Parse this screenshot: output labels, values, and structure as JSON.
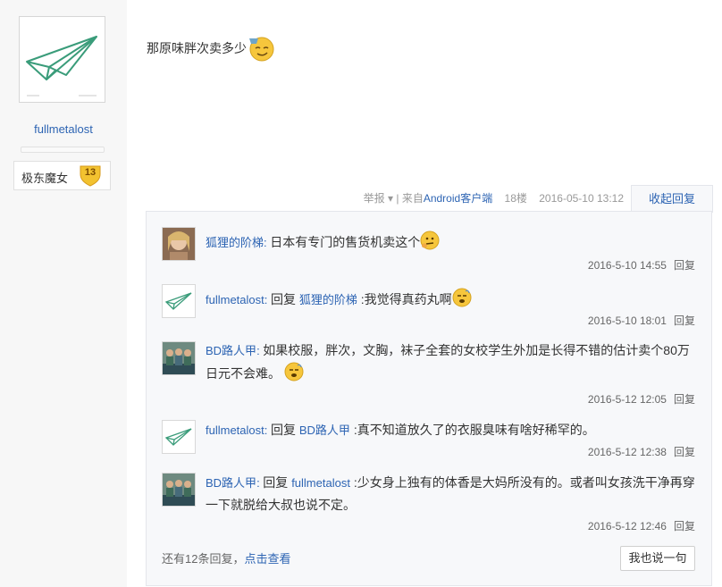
{
  "author": {
    "username": "fullmetalost",
    "badge": {
      "name": "极东魔女",
      "level": "13"
    }
  },
  "post": {
    "text": "那原味胖次卖多少",
    "meta": {
      "report": "举报",
      "source_prefix": "| 来自",
      "source": "Android客户端",
      "floor": "18楼",
      "time": "2016-05-10 13:12"
    },
    "collapse_label": "收起回复"
  },
  "replies": [
    {
      "user": "狐狸的阶梯",
      "text": "日本有专门的售货机卖这个",
      "time": "2016-5-10 14:55",
      "action": "回复"
    },
    {
      "user": "fullmetalost",
      "reply_word": "回复",
      "to": "狐狸的阶梯",
      "text": ":我觉得真药丸啊",
      "time": "2016-5-10 18:01",
      "action": "回复"
    },
    {
      "user": "BD路人甲",
      "text": "如果校服，胖次，文胸，袜子全套的女校学生外加是长得不错的估计卖个80万日元不会难。",
      "time": "2016-5-12 12:05",
      "action": "回复"
    },
    {
      "user": "fullmetalost",
      "reply_word": "回复",
      "to": "BD路人甲",
      "text": ":真不知道放久了的衣服臭味有啥好稀罕的。",
      "time": "2016-5-12 12:38",
      "action": "回复"
    },
    {
      "user": "BD路人甲",
      "reply_word": "回复",
      "to": "fullmetalost",
      "text": ":少女身上独有的体香是大妈所没有的。或者叫女孩洗干净再穿一下就脱给大叔也说不定。",
      "time": "2016-5-12 12:46",
      "action": "回复"
    }
  ],
  "more": {
    "prefix": "还有12条回复，",
    "link": "点击查看"
  },
  "say_button": "我也说一句",
  "colors": {
    "link": "#2d64b3",
    "sidebar_bg": "#f7f7f7",
    "reply_bg": "#f7f8fa",
    "accent_green": "#3a9c7a"
  },
  "icons": [
    "paper-plane-logo",
    "level-badge-icon",
    "emoji-icon",
    "dropdown-arrow-icon"
  ]
}
